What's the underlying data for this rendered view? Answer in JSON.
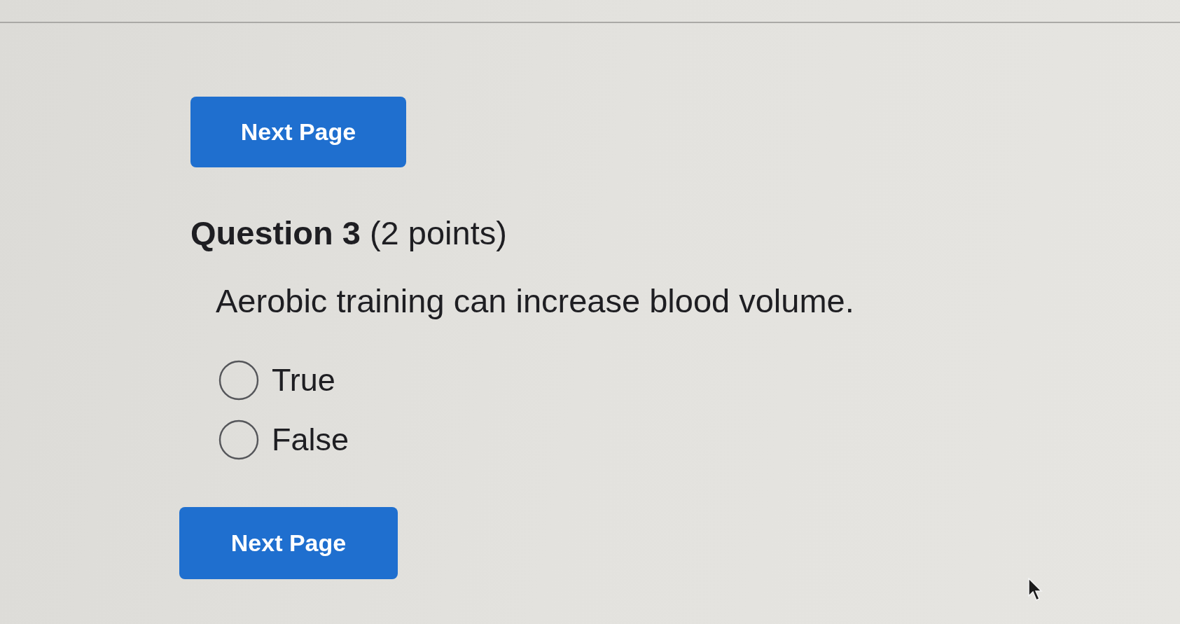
{
  "top_button": {
    "label": "Next Page"
  },
  "question": {
    "heading": "**Question 3** (2 points)",
    "text": "Aerobic training can increase blood volume.",
    "options": [
      {
        "label": "True",
        "selected": false
      },
      {
        "label": "False",
        "selected": false
      }
    ]
  },
  "bottom_button": {
    "label": "Next Page"
  }
}
